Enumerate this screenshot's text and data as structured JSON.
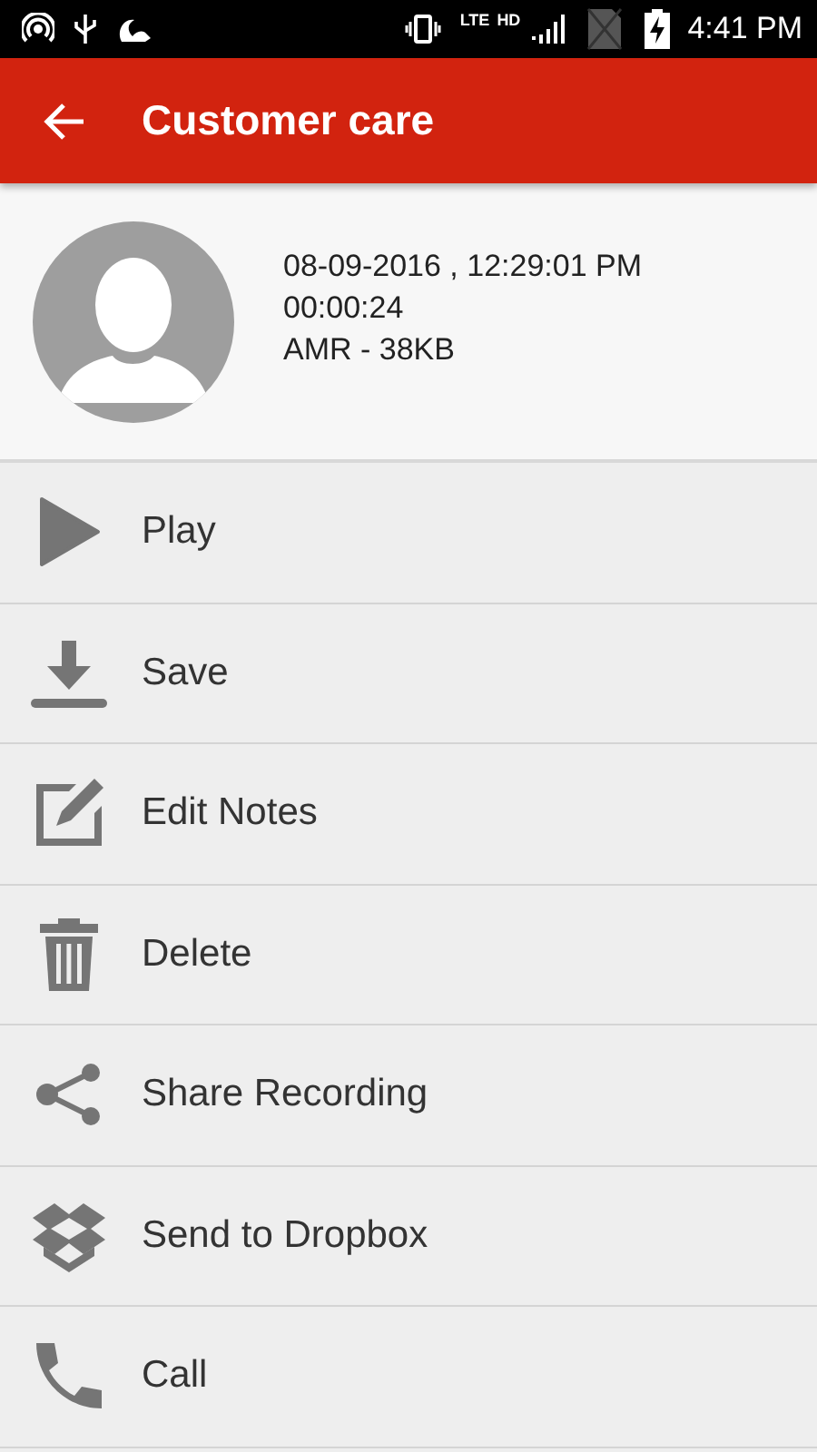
{
  "status_bar": {
    "network": "LTE",
    "quality": "HD",
    "time": "4:41 PM"
  },
  "app_bar": {
    "title": "Customer care"
  },
  "recording": {
    "datetime": "08-09-2016 , 12:29:01 PM",
    "duration": "00:00:24",
    "format": "AMR - 38KB"
  },
  "actions": [
    {
      "kind": "play",
      "label": "Play"
    },
    {
      "kind": "save",
      "label": "Save"
    },
    {
      "kind": "edit",
      "label": "Edit Notes"
    },
    {
      "kind": "delete",
      "label": "Delete"
    },
    {
      "kind": "share",
      "label": "Share Recording"
    },
    {
      "kind": "dropbox",
      "label": "Send to Dropbox"
    },
    {
      "kind": "call",
      "label": "Call"
    }
  ]
}
